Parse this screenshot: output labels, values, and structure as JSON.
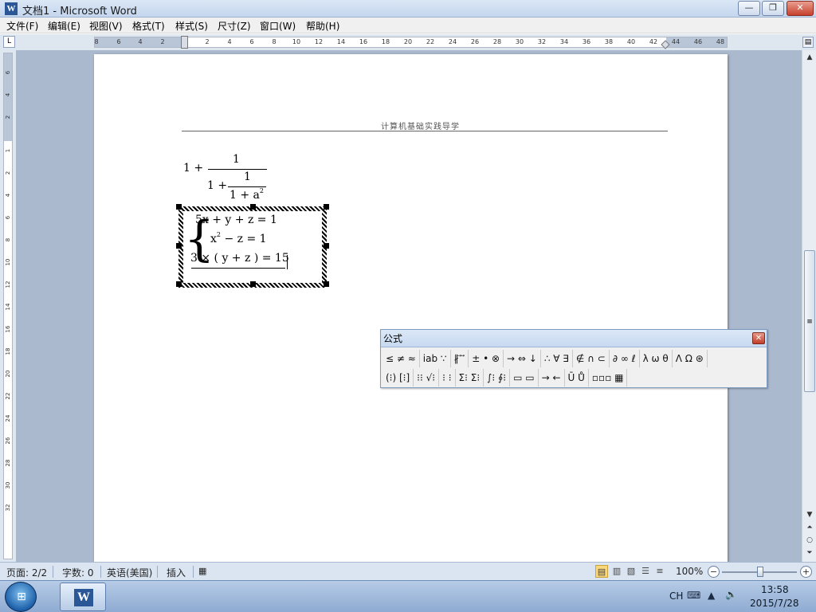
{
  "window": {
    "title": "文档1 - Microsoft Word",
    "app_icon": "W",
    "minimize": "—",
    "maximize": "❐",
    "close": "✕"
  },
  "menu": [
    "文件(F)",
    "编辑(E)",
    "视图(V)",
    "格式(T)",
    "样式(S)",
    "尺寸(Z)",
    "窗口(W)",
    "帮助(H)"
  ],
  "ruler": {
    "tab_selector": "L",
    "ticks": [
      "8",
      "6",
      "4",
      "2",
      "2",
      "4",
      "6",
      "8",
      "10",
      "12",
      "14",
      "16",
      "18",
      "20",
      "22",
      "24",
      "26",
      "28",
      "30",
      "32",
      "34",
      "36",
      "38",
      "40",
      "42",
      "44",
      "46",
      "48"
    ],
    "vticks": [
      "6",
      "4",
      "2",
      "1",
      "2",
      "4",
      "6",
      "8",
      "10",
      "12",
      "14",
      "16",
      "18",
      "20",
      "22",
      "24",
      "26",
      "28",
      "30",
      "32"
    ]
  },
  "document": {
    "header": "计算机基础实践导学",
    "fraction": {
      "lead": "1 +",
      "num1": "1",
      "den_lead": "1 +",
      "num2": "1",
      "den2": "1 + a",
      "den2_exp": "2"
    },
    "system": {
      "eq1": "5x + y + z  = 1",
      "eq2_base": "x",
      "eq2_exp": "2",
      "eq2_rest": " − z  = 1",
      "eq3": "3 × ( y + z ) = 15"
    }
  },
  "equation_toolbar": {
    "title": "公式",
    "close": "✕",
    "row1": [
      "≤ ≠ ≈",
      "ⅰab ∵",
      "∦ ⃗ ⃗",
      "± • ⊗",
      "→ ⇔ ↓",
      "∴ ∀ ∃",
      "∉ ∩ ⊂",
      "∂ ∞ ℓ",
      "λ ω θ",
      "Λ Ω ⊛"
    ],
    "row2": [
      "(⁝) [⁝]",
      "⁝⁝ √⁝",
      "⁝ ⁝",
      "Σ⁝ Σ⁝",
      "∫⁝ ∮⁝",
      "▭ ▭",
      "→ ←",
      "Ū Ů",
      "▫▫▫ ▦"
    ]
  },
  "status": {
    "page": "页面: 2/2",
    "words": "字数: 0",
    "language": "英语(美国)",
    "mode": "插入",
    "zoom": "100%",
    "zoom_minus": "−",
    "zoom_plus": "+"
  },
  "taskbar": {
    "ime": "CH",
    "time": "13:58",
    "date": "2015/7/28"
  }
}
